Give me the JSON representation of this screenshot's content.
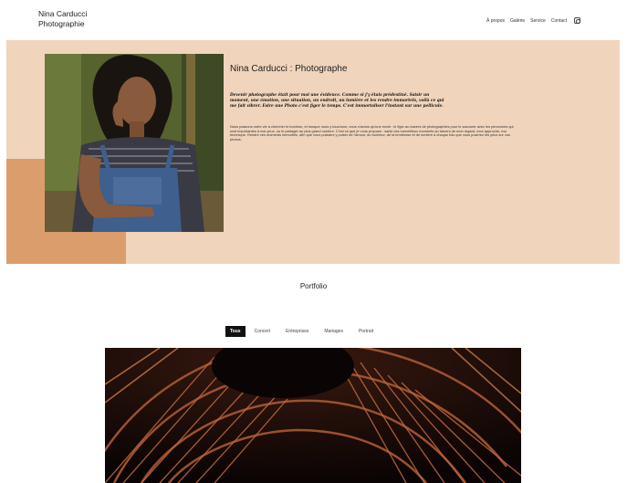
{
  "header": {
    "brand": "Nina Carducci\nPhotographie",
    "nav": [
      "À propos",
      "Galerie",
      "Service",
      "Contact"
    ],
    "social_icon": "instagram-icon"
  },
  "hero": {
    "title": "Nina Carducci : Photographe",
    "quote": "Devenir photographe était pour moi une évidence. Comme si j'y étais prédestiné. Saisir un moment, une émotion, une situation, un endroit, un lumière et les rendre immortels, voilà ce qui me fait vibrer. Faire une Photo c'est figer le temps. C'est immortaliser l'instant sur une pellicule.",
    "body": "Nous passons notre vie à chercher le bonheur, et lorsque nous y touchons, nous n'avons qu'une envie : le figer au travers de photographies pour le savourer avec les personnes qui sont importantes à nos yeux, ou le partager au plus grand nombre. C'est ce que je vous propose : saisir ces merveilleux moments au travers de mon regard, mon approche, ma technique. Rendre ces moments immortels, afin que vous puissiez y puiser de l'amour, du bonheur, de la tendresse et de lumière à chaque fois que vous poserez les yeux sur vos photos."
  },
  "portfolio": {
    "title": "Portfolio",
    "tabs": [
      "Tous",
      "Concert",
      "Entreprises",
      "Mariages",
      "Portrait"
    ],
    "active_tab": "Tous"
  },
  "colors": {
    "hero_bg": "#f0d4bb",
    "accent": "#dc9d6c",
    "active_tab": "#111111"
  }
}
